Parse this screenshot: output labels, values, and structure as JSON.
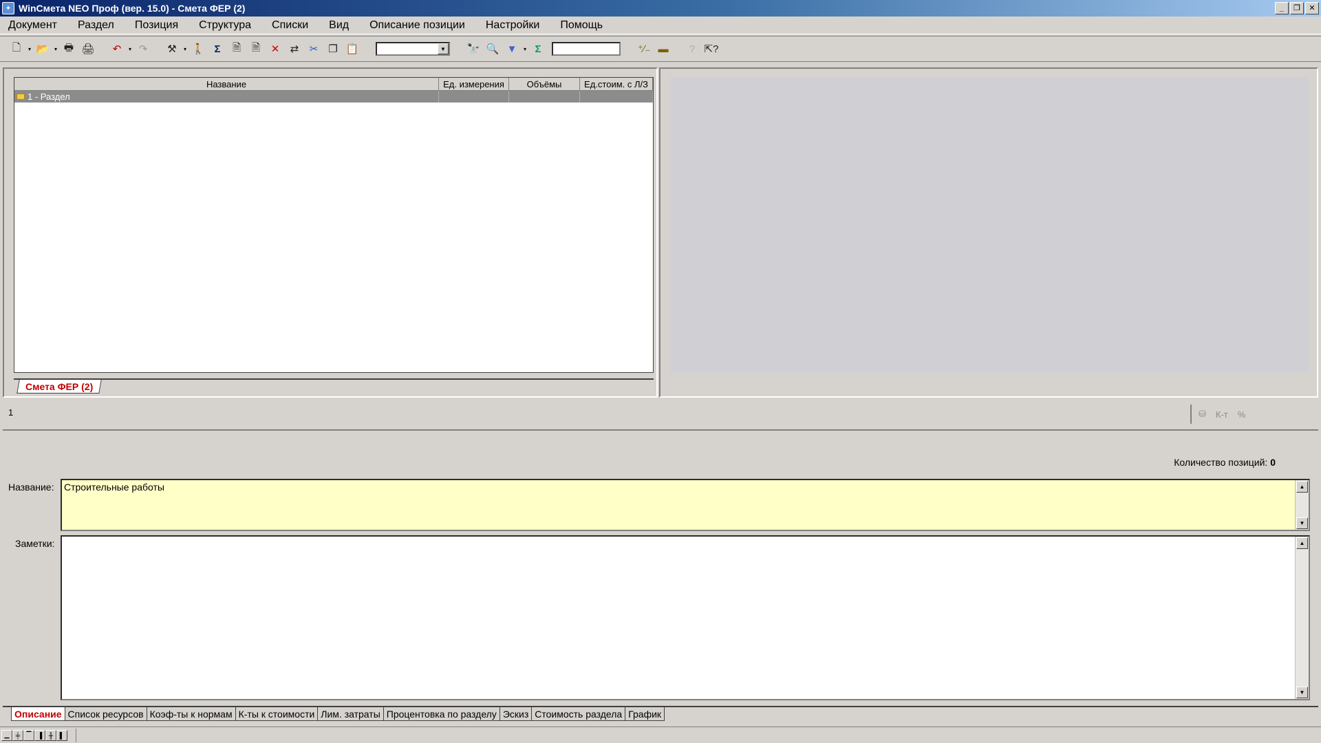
{
  "window": {
    "title": "WinСмета NEO Проф (вер. 15.0) - Смета ФЕР (2)",
    "min_symbol": "_",
    "restore_symbol": "❐",
    "close_symbol": "✕"
  },
  "menu": [
    "Документ",
    "Раздел",
    "Позиция",
    "Структура",
    "Списки",
    "Вид",
    "Описание позиции",
    "Настройки",
    "Помощь"
  ],
  "toolbar": {
    "icons": [
      "new-doc-icon",
      "open-folder-icon",
      "print-icon",
      "print-preview-icon",
      "undo-icon",
      "redo-icon",
      "tools-icon",
      "person-icon",
      "sum-icon",
      "doc-p-icon",
      "doc-n-icon",
      "delete-icon",
      "move-icon",
      "cut-icon",
      "copy-icon",
      "paste-icon",
      "find-icon",
      "find-next-icon",
      "filter-icon",
      "sum-green-icon",
      "percent-icon",
      "minus-icon",
      "help-icon",
      "context-help-icon"
    ],
    "combo_value": "",
    "search_value": ""
  },
  "grid": {
    "columns": [
      "Название",
      "Ед. измерения",
      "Объёмы",
      "Ед.стоим. с Л/З"
    ],
    "rows": [
      {
        "name": "1 - Раздел",
        "unit": "",
        "volume": "",
        "cost": ""
      }
    ]
  },
  "doc_tab": "Смета ФЕР (2)",
  "status": {
    "row_number": "1",
    "icon_labels": [
      "К-т",
      "%"
    ]
  },
  "count": {
    "label": "Количество позиций:",
    "value": "0"
  },
  "fields": {
    "name_label": "Название:",
    "name_value": "Строительные работы",
    "notes_label": "Заметки:",
    "notes_value": ""
  },
  "bottom_tabs": [
    "Описание",
    "Список ресурсов",
    "Коэф-ты к нормам",
    "К-ты к стоимости",
    "Лим. затраты",
    "Процентовка по разделу",
    "Эскиз",
    "Стоимость раздела",
    "График"
  ],
  "colors": {
    "active_tab_text": "#c00000",
    "selected_row": "#8c8c8c",
    "name_field_bg": "#ffffc8"
  }
}
